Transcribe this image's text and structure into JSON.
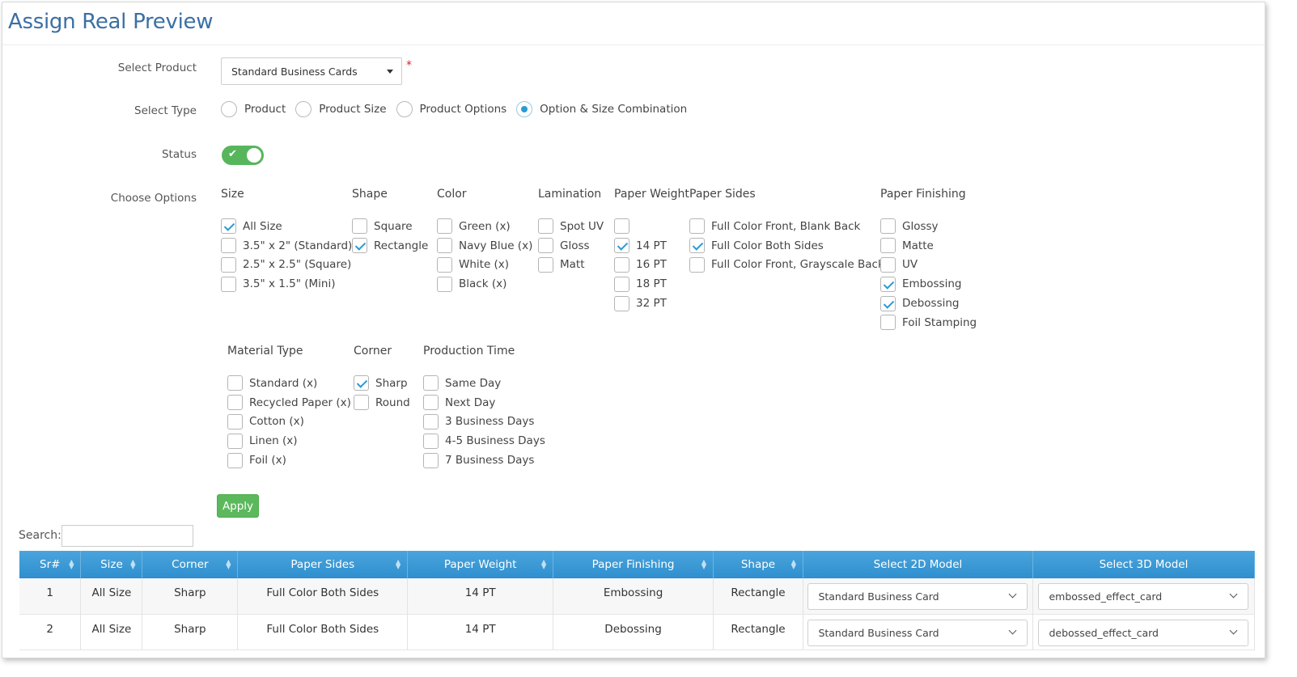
{
  "title": "Assign Real Preview",
  "form": {
    "select_product_label": "Select Product",
    "selected_product": "Standard Business Cards",
    "required_mark": "*",
    "select_type_label": "Select Type",
    "types": [
      {
        "label": "Product",
        "selected": false
      },
      {
        "label": "Product Size",
        "selected": false
      },
      {
        "label": "Product Options",
        "selected": false
      },
      {
        "label": "Option & Size Combination",
        "selected": true
      }
    ],
    "status_label": "Status",
    "status_on": true,
    "choose_options_label": "Choose Options",
    "apply_label": "Apply"
  },
  "options": {
    "size": {
      "title": "Size",
      "items": [
        {
          "label": "All Size",
          "checked": true
        },
        {
          "label": "3.5\" x 2\" (Standard)",
          "checked": false
        },
        {
          "label": "2.5\" x 2.5\" (Square)",
          "checked": false
        },
        {
          "label": "3.5\" x 1.5\" (Mini)",
          "checked": false
        }
      ]
    },
    "shape": {
      "title": "Shape",
      "items": [
        {
          "label": "Square",
          "checked": false
        },
        {
          "label": "Rectangle",
          "checked": true
        }
      ]
    },
    "color": {
      "title": "Color",
      "items": [
        {
          "label": "Green (x)",
          "checked": false
        },
        {
          "label": "Navy Blue (x)",
          "checked": false
        },
        {
          "label": "White (x)",
          "checked": false
        },
        {
          "label": "Black (x)",
          "checked": false
        }
      ]
    },
    "lamination": {
      "title": "Lamination",
      "items": [
        {
          "label": "Spot UV",
          "checked": false
        },
        {
          "label": "Gloss",
          "checked": false
        },
        {
          "label": "Matt",
          "checked": false
        }
      ]
    },
    "paper_weight": {
      "title": "Paper Weight",
      "items": [
        {
          "label": "",
          "checked": false
        },
        {
          "label": "14 PT",
          "checked": true
        },
        {
          "label": "16 PT",
          "checked": false
        },
        {
          "label": "18 PT",
          "checked": false
        },
        {
          "label": "32 PT",
          "checked": false
        }
      ]
    },
    "paper_sides": {
      "title": "Paper Sides",
      "items": [
        {
          "label": "Full Color Front, Blank Back",
          "checked": false
        },
        {
          "label": "Full Color Both Sides",
          "checked": true
        },
        {
          "label": "Full Color Front, Grayscale Back",
          "checked": false
        }
      ]
    },
    "paper_finishing": {
      "title": "Paper Finishing",
      "items": [
        {
          "label": "Glossy",
          "checked": false
        },
        {
          "label": "Matte",
          "checked": false
        },
        {
          "label": "UV",
          "checked": false
        },
        {
          "label": "Embossing",
          "checked": true
        },
        {
          "label": "Debossing",
          "checked": true
        },
        {
          "label": "Foil Stamping",
          "checked": false
        }
      ]
    },
    "material_type": {
      "title": "Material Type",
      "items": [
        {
          "label": "Standard (x)",
          "checked": false
        },
        {
          "label": "Recycled Paper (x)",
          "checked": false
        },
        {
          "label": "Cotton (x)",
          "checked": false
        },
        {
          "label": "Linen (x)",
          "checked": false
        },
        {
          "label": "Foil (x)",
          "checked": false
        }
      ]
    },
    "corner": {
      "title": "Corner",
      "items": [
        {
          "label": "Sharp",
          "checked": true
        },
        {
          "label": "Round",
          "checked": false
        }
      ]
    },
    "production_time": {
      "title": "Production Time",
      "items": [
        {
          "label": "Same Day",
          "checked": false
        },
        {
          "label": "Next Day",
          "checked": false
        },
        {
          "label": "3 Business Days",
          "checked": false
        },
        {
          "label": "4-5 Business Days",
          "checked": false
        },
        {
          "label": "7 Business Days",
          "checked": false
        }
      ]
    }
  },
  "search": {
    "label": "Search:",
    "value": ""
  },
  "table": {
    "columns": [
      "Sr#",
      "Size",
      "Corner",
      "Paper Sides",
      "Paper Weight",
      "Paper Finishing",
      "Shape",
      "Select 2D Model",
      "Select 3D Model"
    ],
    "rows": [
      {
        "sr": "1",
        "size": "All Size",
        "corner": "Sharp",
        "paper_sides": "Full Color Both Sides",
        "paper_weight": "14 PT",
        "finishing": "Embossing",
        "shape": "Rectangle",
        "model_2d": "Standard Business Card",
        "model_3d": "embossed_effect_card"
      },
      {
        "sr": "2",
        "size": "All Size",
        "corner": "Sharp",
        "paper_sides": "Full Color Both Sides",
        "paper_weight": "14 PT",
        "finishing": "Debossing",
        "shape": "Rectangle",
        "model_2d": "Standard Business Card",
        "model_3d": "debossed_effect_card"
      }
    ]
  }
}
